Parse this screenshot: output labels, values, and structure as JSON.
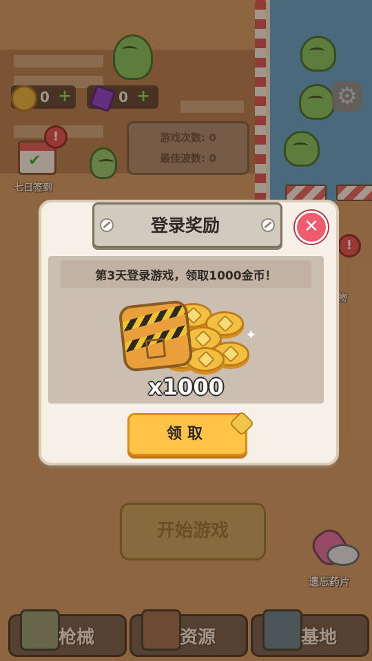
{
  "hud": {
    "coins": "0",
    "gems": "0",
    "plus": "+",
    "stats": {
      "games_played_label": "游戏次数:",
      "games_played_value": "0",
      "best_wave_label": "最佳波数:",
      "best_wave_value": "0"
    },
    "gear_glyph": "⚙"
  },
  "side": {
    "seven_day_label": "七日签到",
    "pet_label_partial": "物",
    "forget_pill_label": "遗忘药片",
    "alert_glyph": "!"
  },
  "start_button": "开始游戏",
  "bottom_nav": [
    {
      "label": "枪械",
      "icon": "gun-icon"
    },
    {
      "label": "资源",
      "icon": "resource-icon"
    },
    {
      "label": "基地",
      "icon": "base-icon"
    }
  ],
  "dialog": {
    "title": "登录奖励",
    "close_glyph": "✕",
    "description": "第3天登录游戏，领取1000金币！",
    "amount": "x1000",
    "claim_label": "领取",
    "sparkle_glyph": "✦"
  },
  "colors": {
    "close_button": "#ef5a6c",
    "claim_button": "#ffc445",
    "coin": "#f2c040"
  }
}
